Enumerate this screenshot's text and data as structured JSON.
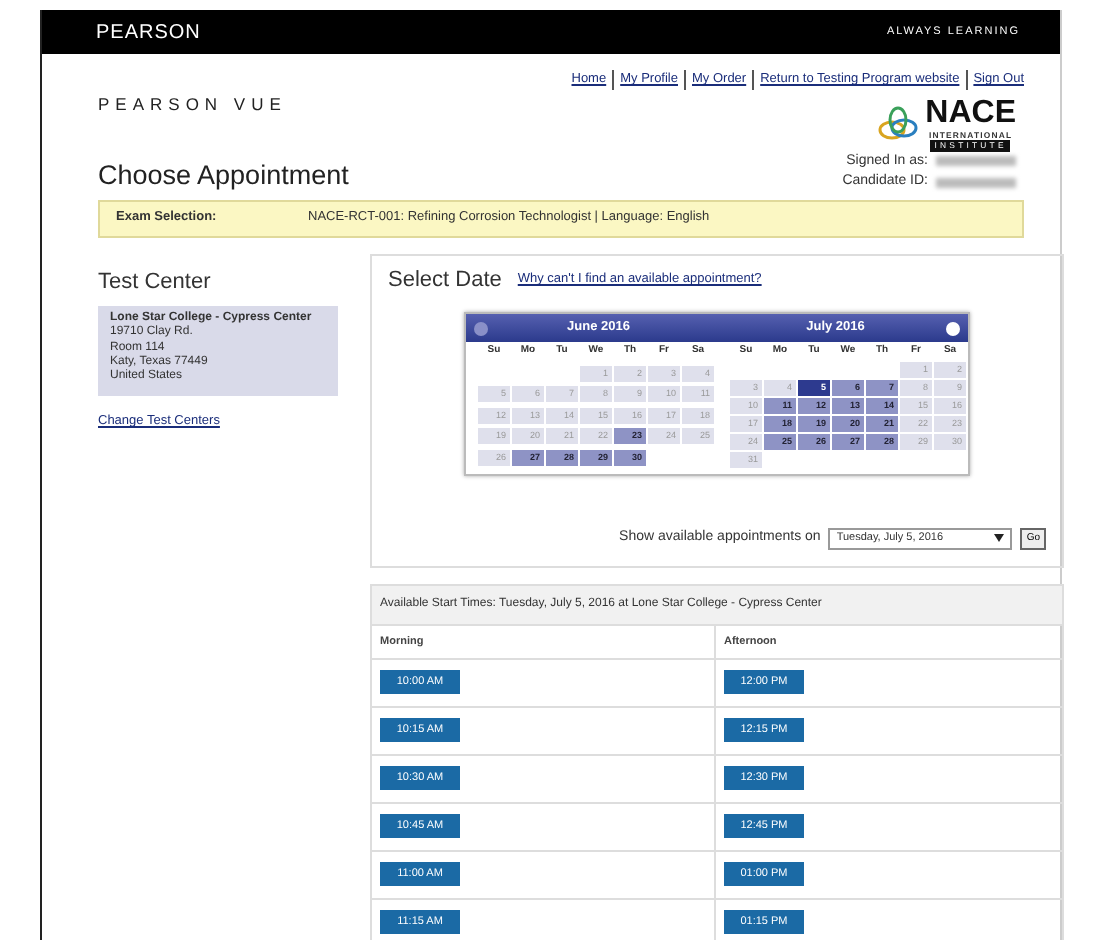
{
  "top_bar": {
    "brand": "PEARSON",
    "tagline": "ALWAYS LEARNING"
  },
  "header": {
    "logo": "PEARSON VUE",
    "links": [
      "Home",
      "My Profile",
      "My Order",
      "Return to Testing Program website",
      "Sign Out"
    ],
    "partner_logo": {
      "name": "NACE",
      "line_1": "INTERNATIONAL",
      "line_2": "INSTITUTE"
    },
    "signed_in_label": "Signed In as:",
    "candidate_label": "Candidate ID:"
  },
  "page_title": "Choose Appointment",
  "exam_bar": {
    "label": "Exam Selection:",
    "value": "NACE-RCT-001: Refining Corrosion Technologist | Language: English"
  },
  "test_center": {
    "heading": "Test Center",
    "lines": [
      "Lone Star College - Cypress Center",
      "19710 Clay Rd.",
      "Room 114",
      "Katy, Texas 77449",
      "United States"
    ],
    "change_link": "Change Test Centers"
  },
  "select_date": {
    "heading": "Select Date",
    "help_link": "Why can't I find an available appointment?"
  },
  "calendar": {
    "months": [
      {
        "title": "June 2016",
        "weekdays": [
          "Su",
          "Mo",
          "Tu",
          "We",
          "Th",
          "Fr",
          "Sa"
        ],
        "days": [
          {
            "kind": "blank"
          },
          {
            "kind": "blank"
          },
          {
            "kind": "blank"
          },
          {
            "kind": "day",
            "label": "1",
            "available": false,
            "selected": false
          },
          {
            "kind": "day",
            "label": "2",
            "available": false,
            "selected": false
          },
          {
            "kind": "day",
            "label": "3",
            "available": false,
            "selected": false
          },
          {
            "kind": "day",
            "label": "4",
            "available": false,
            "selected": false
          },
          {
            "kind": "day",
            "label": "5",
            "available": false,
            "selected": false
          },
          {
            "kind": "day",
            "label": "6",
            "available": false,
            "selected": false
          },
          {
            "kind": "day",
            "label": "7",
            "available": false,
            "selected": false
          },
          {
            "kind": "day",
            "label": "8",
            "available": false,
            "selected": false
          },
          {
            "kind": "day",
            "label": "9",
            "available": false,
            "selected": false
          },
          {
            "kind": "day",
            "label": "10",
            "available": false,
            "selected": false
          },
          {
            "kind": "day",
            "label": "11",
            "available": false,
            "selected": false
          },
          {
            "kind": "day",
            "label": "12",
            "available": false,
            "selected": false
          },
          {
            "kind": "day",
            "label": "13",
            "available": false,
            "selected": false
          },
          {
            "kind": "day",
            "label": "14",
            "available": false,
            "selected": false
          },
          {
            "kind": "day",
            "label": "15",
            "available": false,
            "selected": false
          },
          {
            "kind": "day",
            "label": "16",
            "available": false,
            "selected": false
          },
          {
            "kind": "day",
            "label": "17",
            "available": false,
            "selected": false
          },
          {
            "kind": "day",
            "label": "18",
            "available": false,
            "selected": false
          },
          {
            "kind": "day",
            "label": "19",
            "available": false,
            "selected": false
          },
          {
            "kind": "day",
            "label": "20",
            "available": false,
            "selected": false
          },
          {
            "kind": "day",
            "label": "21",
            "available": false,
            "selected": false
          },
          {
            "kind": "day",
            "label": "22",
            "available": false,
            "selected": false
          },
          {
            "kind": "day",
            "label": "23",
            "available": true,
            "selected": false
          },
          {
            "kind": "day",
            "label": "24",
            "available": false,
            "selected": false
          },
          {
            "kind": "day",
            "label": "25",
            "available": false,
            "selected": false
          },
          {
            "kind": "day",
            "label": "26",
            "available": false,
            "selected": false
          },
          {
            "kind": "day",
            "label": "27",
            "available": true,
            "selected": false
          },
          {
            "kind": "day",
            "label": "28",
            "available": true,
            "selected": false
          },
          {
            "kind": "day",
            "label": "29",
            "available": true,
            "selected": false
          },
          {
            "kind": "day",
            "label": "30",
            "available": true,
            "selected": false
          }
        ]
      },
      {
        "title": "July 2016",
        "weekdays": [
          "Su",
          "Mo",
          "Tu",
          "We",
          "Th",
          "Fr",
          "Sa"
        ],
        "days": [
          {
            "kind": "blank"
          },
          {
            "kind": "blank"
          },
          {
            "kind": "blank"
          },
          {
            "kind": "blank"
          },
          {
            "kind": "blank"
          },
          {
            "kind": "day",
            "label": "1",
            "available": false,
            "selected": false
          },
          {
            "kind": "day",
            "label": "2",
            "available": false,
            "selected": false
          },
          {
            "kind": "day",
            "label": "3",
            "available": false,
            "selected": false
          },
          {
            "kind": "day",
            "label": "4",
            "available": false,
            "selected": false
          },
          {
            "kind": "day",
            "label": "5",
            "available": true,
            "selected": true
          },
          {
            "kind": "day",
            "label": "6",
            "available": true,
            "selected": false
          },
          {
            "kind": "day",
            "label": "7",
            "available": true,
            "selected": false
          },
          {
            "kind": "day",
            "label": "8",
            "available": false,
            "selected": false
          },
          {
            "kind": "day",
            "label": "9",
            "available": false,
            "selected": false
          },
          {
            "kind": "day",
            "label": "10",
            "available": false,
            "selected": false
          },
          {
            "kind": "day",
            "label": "11",
            "available": true,
            "selected": false
          },
          {
            "kind": "day",
            "label": "12",
            "available": true,
            "selected": false
          },
          {
            "kind": "day",
            "label": "13",
            "available": true,
            "selected": false
          },
          {
            "kind": "day",
            "label": "14",
            "available": true,
            "selected": false
          },
          {
            "kind": "day",
            "label": "15",
            "available": false,
            "selected": false
          },
          {
            "kind": "day",
            "label": "16",
            "available": false,
            "selected": false
          },
          {
            "kind": "day",
            "label": "17",
            "available": false,
            "selected": false
          },
          {
            "kind": "day",
            "label": "18",
            "available": true,
            "selected": false
          },
          {
            "kind": "day",
            "label": "19",
            "available": true,
            "selected": false
          },
          {
            "kind": "day",
            "label": "20",
            "available": true,
            "selected": false
          },
          {
            "kind": "day",
            "label": "21",
            "available": true,
            "selected": false
          },
          {
            "kind": "day",
            "label": "22",
            "available": false,
            "selected": false
          },
          {
            "kind": "day",
            "label": "23",
            "available": false,
            "selected": false
          },
          {
            "kind": "day",
            "label": "24",
            "available": false,
            "selected": false
          },
          {
            "kind": "day",
            "label": "25",
            "available": true,
            "selected": false
          },
          {
            "kind": "day",
            "label": "26",
            "available": true,
            "selected": false
          },
          {
            "kind": "day",
            "label": "27",
            "available": true,
            "selected": false
          },
          {
            "kind": "day",
            "label": "28",
            "available": true,
            "selected": false
          },
          {
            "kind": "day",
            "label": "29",
            "available": false,
            "selected": false
          },
          {
            "kind": "day",
            "label": "30",
            "available": false,
            "selected": false
          },
          {
            "kind": "day",
            "label": "31",
            "available": false,
            "selected": false
          }
        ]
      }
    ]
  },
  "date_picker": {
    "label": "Show available appointments on",
    "value": "Tuesday, July 5, 2016",
    "button": "Go"
  },
  "times": {
    "title": "Available Start Times: Tuesday, July 5, 2016 at Lone Star College - Cypress Center",
    "columns": [
      "Morning",
      "Afternoon"
    ],
    "rows": [
      [
        "10:00 AM",
        "12:00 PM"
      ],
      [
        "10:15 AM",
        "12:15 PM"
      ],
      [
        "10:30 AM",
        "12:30 PM"
      ],
      [
        "10:45 AM",
        "12:45 PM"
      ],
      [
        "11:00 AM",
        "01:00 PM"
      ],
      [
        "11:15 AM",
        "01:15 PM"
      ]
    ]
  }
}
